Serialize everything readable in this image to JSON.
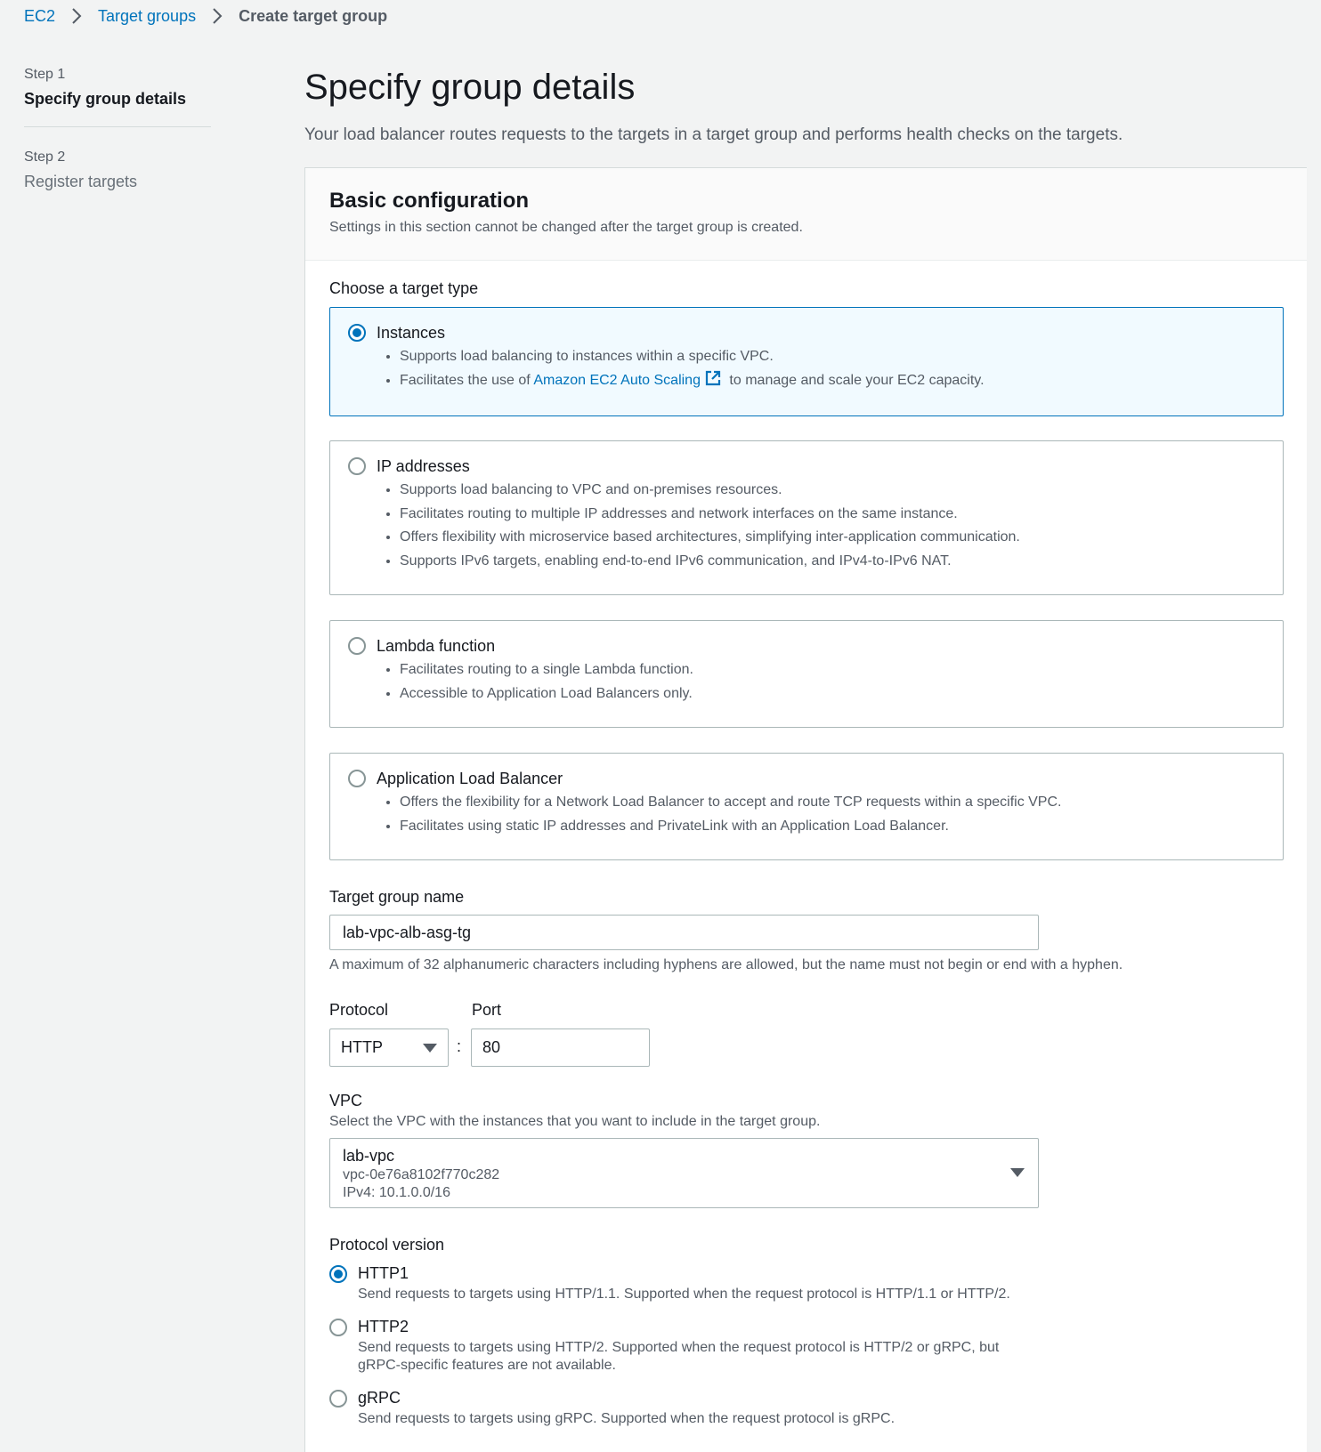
{
  "breadcrumb": {
    "items": [
      "EC2",
      "Target groups"
    ],
    "current": "Create target group"
  },
  "steps": [
    {
      "num": "Step 1",
      "title": "Specify group details",
      "active": true
    },
    {
      "num": "Step 2",
      "title": "Register targets",
      "active": false
    }
  ],
  "page": {
    "title": "Specify group details",
    "description": "Your load balancer routes requests to the targets in a target group and performs health checks on the targets."
  },
  "basic_config": {
    "title": "Basic configuration",
    "subtitle": "Settings in this section cannot be changed after the target group is created.",
    "target_type_label": "Choose a target type",
    "target_types": [
      {
        "title": "Instances",
        "selected": true,
        "bullets": [
          "Supports load balancing to instances within a specific VPC."
        ],
        "bullet_with_link": {
          "before": "Facilitates the use of ",
          "link": "Amazon EC2 Auto Scaling",
          "after": " to manage and scale your EC2 capacity."
        }
      },
      {
        "title": "IP addresses",
        "selected": false,
        "bullets": [
          "Supports load balancing to VPC and on-premises resources.",
          "Facilitates routing to multiple IP addresses and network interfaces on the same instance.",
          "Offers flexibility with microservice based architectures, simplifying inter-application communication.",
          "Supports IPv6 targets, enabling end-to-end IPv6 communication, and IPv4-to-IPv6 NAT."
        ]
      },
      {
        "title": "Lambda function",
        "selected": false,
        "bullets": [
          "Facilitates routing to a single Lambda function.",
          "Accessible to Application Load Balancers only."
        ]
      },
      {
        "title": "Application Load Balancer",
        "selected": false,
        "bullets": [
          "Offers the flexibility for a Network Load Balancer to accept and route TCP requests within a specific VPC.",
          "Facilitates using static IP addresses and PrivateLink with an Application Load Balancer."
        ]
      }
    ],
    "name_label": "Target group name",
    "name_value": "lab-vpc-alb-asg-tg",
    "name_hint": "A maximum of 32 alphanumeric characters including hyphens are allowed, but the name must not begin or end with a hyphen.",
    "protocol_label": "Protocol",
    "protocol_value": "HTTP",
    "port_separator": ":",
    "port_label": "Port",
    "port_value": "80",
    "vpc_label": "VPC",
    "vpc_desc": "Select the VPC with the instances that you want to include in the target group.",
    "vpc_name": "lab-vpc",
    "vpc_id": "vpc-0e76a8102f770c282",
    "vpc_cidr": "IPv4: 10.1.0.0/16",
    "protocol_version_label": "Protocol version",
    "protocol_versions": [
      {
        "title": "HTTP1",
        "desc": "Send requests to targets using HTTP/1.1. Supported when the request protocol is HTTP/1.1 or HTTP/2.",
        "selected": true
      },
      {
        "title": "HTTP2",
        "desc": "Send requests to targets using HTTP/2. Supported when the request protocol is HTTP/2 or gRPC, but",
        "desc2": "gRPC-specific features are not available.",
        "selected": false
      },
      {
        "title": "gRPC",
        "desc": "Send requests to targets using gRPC. Supported when the request protocol is gRPC.",
        "selected": false
      }
    ]
  },
  "colors": {
    "link": "#0073bb",
    "background": "#f2f3f3",
    "selected_tile_bg": "#f1faff"
  }
}
